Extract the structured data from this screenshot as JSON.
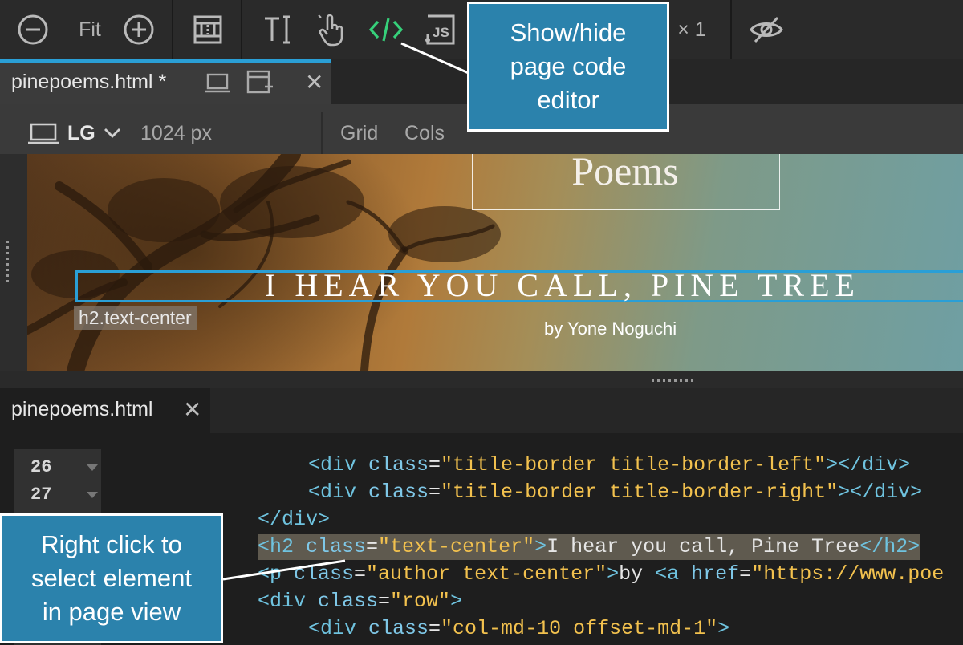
{
  "toolbar": {
    "fit_label": "Fit",
    "multiplier_label": "× 1",
    "icons": [
      "zoom-out-icon",
      "zoom-in-icon",
      "layout-icon",
      "text-cursor-icon",
      "hand-pointer-icon",
      "code-icon",
      "js-icon",
      "eye-slash-icon"
    ],
    "accent_code_icon": "#36d07a"
  },
  "tab": {
    "filename": "pinepoems.html",
    "modified_marker": "*"
  },
  "device_bar": {
    "device": "LG",
    "width": "1024 px",
    "grid_label": "Grid",
    "cols_label": "Cols"
  },
  "page_view": {
    "heading_fragment": "Poems",
    "h2_text": "I HEAR YOU CALL, PINE TREE",
    "author_line": "by Yone Noguchi",
    "selection_label": "h2.text-center",
    "selection_color": "#2a9fd6"
  },
  "code_tab": {
    "filename": "pinepoems.html"
  },
  "code": {
    "line_numbers": [
      "26",
      "27"
    ],
    "lines": [
      {
        "indent": "      ",
        "tag_open": "<div ",
        "attr": "class",
        "eq": "=",
        "val": "\"title-border title-border-left\"",
        "tail": "></div>"
      },
      {
        "indent": "      ",
        "tag_open": "<div ",
        "attr": "class",
        "eq": "=",
        "val": "\"title-border title-border-right\"",
        "tail": "></div>"
      },
      {
        "indent": "  ",
        "tag_open": "</div>",
        "attr": "",
        "eq": "",
        "val": "",
        "tail": ""
      },
      {
        "indent": "  ",
        "tag_open": "<h2 ",
        "attr": "class",
        "eq": "=",
        "val": "\"text-center\"",
        "tail": ">",
        "text": "I hear you call, Pine Tree",
        "close": "</h2>"
      },
      {
        "indent": "  ",
        "tag_open": "<p ",
        "attr": "class",
        "eq": "=",
        "val": "\"author text-center\"",
        "tail": ">",
        "text": "by ",
        "a_open": "<a ",
        "a_attr": "href",
        "a_eq": "=",
        "a_val": "\"https://www.poe"
      },
      {
        "indent": "  ",
        "tag_open": "<div ",
        "attr": "class",
        "eq": "=",
        "val": "\"row\"",
        "tail": ">"
      },
      {
        "indent": "      ",
        "tag_open": "<div ",
        "attr": "class",
        "eq": "=",
        "val": "\"col-md-10 offset-md-1\"",
        "tail": ">"
      }
    ]
  },
  "callouts": {
    "top": "Show/hide page code editor",
    "top_lines": [
      "Show/hide",
      "page code",
      "editor"
    ],
    "bottom_lines": [
      "Right click to",
      "select element",
      "in page view"
    ]
  }
}
